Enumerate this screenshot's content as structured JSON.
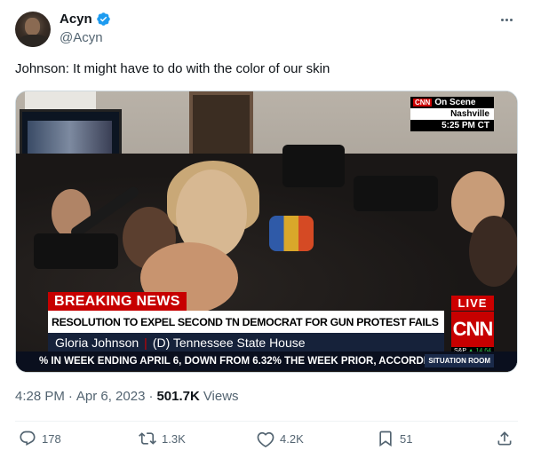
{
  "author": {
    "display_name": "Acyn",
    "handle": "@Acyn"
  },
  "tweet_text": "Johnson: It might have to do with the color of our skin",
  "media": {
    "cnn": {
      "mini_logo": "CNN",
      "on_scene": "On Scene",
      "location": "Nashville",
      "time": "5:25 PM CT",
      "breaking": "BREAKING NEWS",
      "headline": "RESOLUTION TO EXPEL SECOND TN DEMOCRAT FOR GUN PROTEST FAILS",
      "name": "Gloria Johnson",
      "separator": "|",
      "title": "(D) Tennessee State House",
      "live": "LIVE",
      "logo": "CNN",
      "sp_label": "S&P",
      "sp_value": "▲ 14.64",
      "ticker": "% IN WEEK ENDING APRIL 6, DOWN FROM 6.32% THE WEEK PRIOR, ACCORDI",
      "show": "SITUATION ROOM"
    }
  },
  "meta": {
    "time": "4:28 PM",
    "dot1": "·",
    "date": "Apr 6, 2023",
    "dot2": "·",
    "views_count": "501.7K",
    "views_label": "Views"
  },
  "actions": {
    "replies": "178",
    "retweets": "1.3K",
    "likes": "4.2K",
    "bookmarks": "51"
  },
  "colors": {
    "verified": "#1d9bf0",
    "text_secondary": "#536471",
    "cnn_red": "#c70000"
  },
  "icons": {
    "verified": "verified-badge-icon",
    "more": "more-icon",
    "reply": "reply-icon",
    "retweet": "retweet-icon",
    "like": "heart-icon",
    "bookmark": "bookmark-icon",
    "share": "share-icon"
  }
}
